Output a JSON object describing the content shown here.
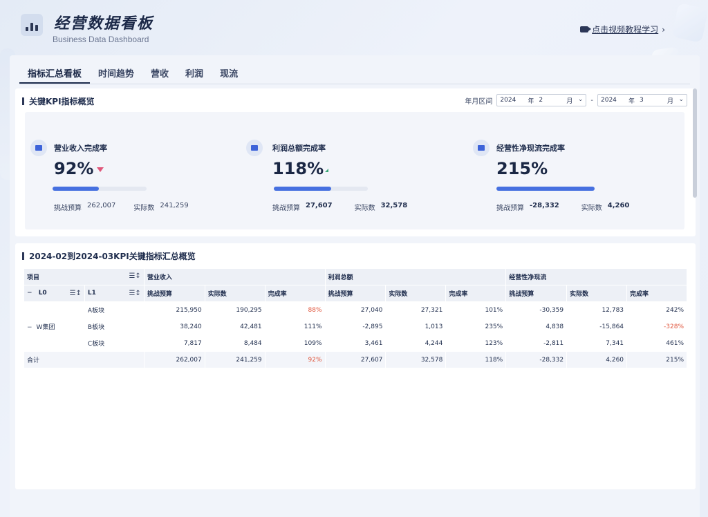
{
  "header": {
    "title": "经营数据看板",
    "subtitle": "Business Data Dashboard",
    "video_link": "点击视频教程学习",
    "video_chevron": "›"
  },
  "tabs": [
    {
      "label": "指标汇总看板",
      "active": true
    },
    {
      "label": "时间趋势",
      "active": false
    },
    {
      "label": "营收",
      "active": false
    },
    {
      "label": "利润",
      "active": false
    },
    {
      "label": "现流",
      "active": false
    }
  ],
  "kpi_section": {
    "title": "关键KPI指标概览",
    "period_label": "年月区间",
    "period_start": {
      "year": "2024",
      "year_unit": "年",
      "month": "2",
      "month_unit": "月"
    },
    "period_separator": "-",
    "period_end": {
      "year": "2024",
      "year_unit": "年",
      "month": "3",
      "month_unit": "月"
    },
    "cards": [
      {
        "label": "营业收入完成率",
        "value": "92%",
        "trend": "down",
        "progress": 0.49,
        "budget_label": "挑战预算",
        "budget": "262,007",
        "actual_label": "实际数",
        "actual": "241,259",
        "icon": "wallet-icon"
      },
      {
        "label": "利润总额完成率",
        "value": "118%",
        "trend": "up",
        "progress": 0.61,
        "budget_label": "挑战预算",
        "budget": "27,607",
        "actual_label": "实际数",
        "actual": "32,578",
        "icon": "trend-chart-icon"
      },
      {
        "label": "经营性净现流完成率",
        "value": "215%",
        "trend": "none",
        "progress": 1.0,
        "budget_label": "挑战预算",
        "budget": "-28,332",
        "actual_label": "实际数",
        "actual": "4,260",
        "icon": "people-icon"
      }
    ]
  },
  "table_section": {
    "title": "2024-02到2024-03KPI关键指标汇总概览",
    "header_top": {
      "item": "项目",
      "revenue": "营业收入",
      "profit": "利润总额",
      "cashflow": "经营性净现流"
    },
    "header_sub": {
      "l0": "L0",
      "l1": "L1",
      "budget": "挑战预算",
      "actual": "实际数",
      "rate": "完成率"
    },
    "group_label": "W集团",
    "total_label": "合计",
    "rows": [
      {
        "l1": "A板块",
        "cells": [
          "215,950",
          "190,295",
          "88%",
          "27,040",
          "27,321",
          "101%",
          "-30,359",
          "12,783",
          "242%"
        ]
      },
      {
        "l1": "B板块",
        "cells": [
          "38,240",
          "42,481",
          "111%",
          "-2,895",
          "1,013",
          "235%",
          "4,838",
          "-15,864",
          "-328%"
        ]
      },
      {
        "l1": "C板块",
        "cells": [
          "7,817",
          "8,484",
          "109%",
          "3,461",
          "4,244",
          "123%",
          "-2,811",
          "7,341",
          "461%"
        ]
      }
    ],
    "total": [
      "262,007",
      "241,259",
      "92%",
      "27,607",
      "32,578",
      "118%",
      "-28,332",
      "4,260",
      "215%"
    ],
    "highlight_color": "#e0553c"
  },
  "colors": {
    "accent": "#4670e0",
    "down_arrow": "#e0577a",
    "up_arrow": "#3aa876"
  }
}
